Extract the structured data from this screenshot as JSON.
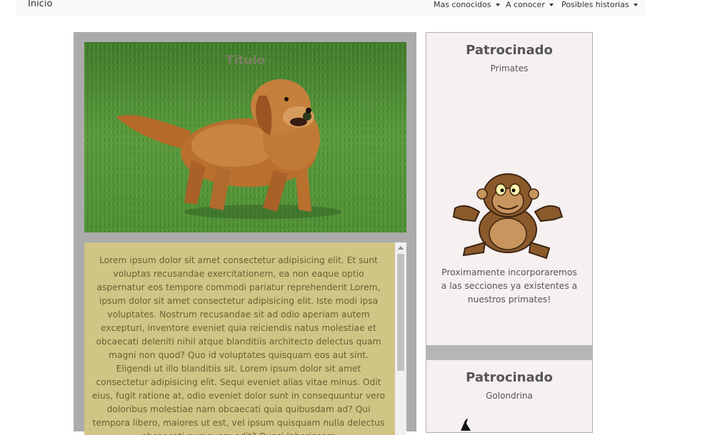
{
  "navbar": {
    "brand": "Inicio",
    "menu": [
      {
        "label": "Mas conocidos"
      },
      {
        "label": "A conocer"
      },
      {
        "label": "Posibles historias"
      }
    ]
  },
  "hero": {
    "title": "Titulo"
  },
  "article": {
    "text": "Lorem ipsum dolor sit amet consectetur adipisicing elit. Et sunt voluptas recusandae exercitationem, ea non eaque optio aspernatur eos tempore commodi pariatur reprehenderit Lorem, ipsum dolor sit amet consectetur adipisicing elit. Iste modi ipsa voluptates. Nostrum recusandae sit ad odio aperiam autem excepturi, inventore eveniet quia reiciendis natus molestiae et obcaecati deleniti nihil atque blanditiis architecto delectus quam magni non quod? Quo id voluptates quisquam eos aut sint. Eligendi ut illo blanditiis sit. Lorem ipsum dolor sit amet consectetur adipisicing elit. Sequi eveniet alias vitae minus. Odit eius, fugit ratione at, odio eveniet dolor sunt in consequuntur vero doloribus molestiae nam obcaecati quia quibusdam ad? Qui tempora libero, maiores ut est, vel ipsum quisquam nulla delectus obcaecati numquam odit? Quasi laboriosam"
  },
  "sidebar": {
    "sponsors": [
      {
        "title": "Patrocinado",
        "subtitle": "Primates",
        "text": "Proximamente incorporaremos a las secciones ya existentes a nuestros primates!"
      },
      {
        "title": "Patrocinado",
        "subtitle": "Golondrina"
      }
    ]
  }
}
